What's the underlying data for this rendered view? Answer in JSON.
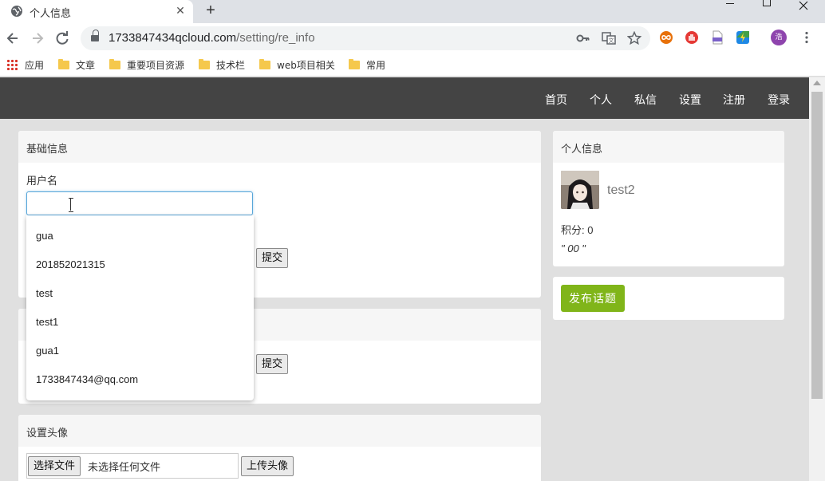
{
  "browser": {
    "tab_title": "个人信息",
    "tab_close": "✕",
    "new_tab": "+",
    "url_host": "1733847434qcloud.com",
    "url_path": "/setting/re_info",
    "profile_initial": "浩",
    "bookmarks": [
      "应用",
      "文章",
      "重要项目资源",
      "技术栏",
      "web项目相关",
      "常用"
    ]
  },
  "nav": {
    "items": [
      "首页",
      "个人",
      "私信",
      "设置",
      "注册",
      "登录"
    ]
  },
  "basic_info": {
    "header": "基础信息",
    "username_label": "用户名",
    "username_value": "",
    "submit": "提交"
  },
  "second_panel": {
    "submit": "提交"
  },
  "autocomplete": {
    "options": [
      "gua",
      "201852021315",
      "test",
      "test1",
      "gua1",
      "1733847434@qq.com"
    ]
  },
  "avatar_panel": {
    "header": "设置头像",
    "choose_file": "选择文件",
    "no_file": "未选择任何文件",
    "upload": "上传头像"
  },
  "profile": {
    "header": "个人信息",
    "username": "test2",
    "score": "积分: 0",
    "signature": "\" 00 \""
  },
  "publish": {
    "label": "发布话题"
  },
  "colors": {
    "navbar": "#444444",
    "publish_button": "#80b519",
    "input_focus": "#58a6d9"
  }
}
